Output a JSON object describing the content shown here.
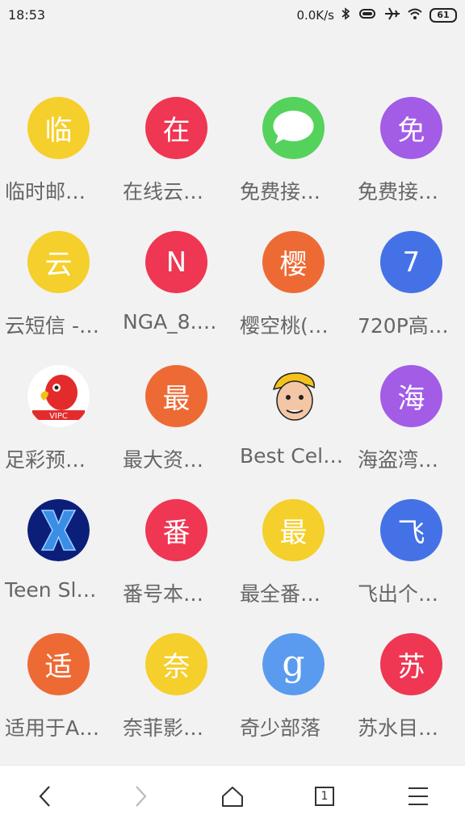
{
  "status": {
    "time": "18:53",
    "net_speed": "0.0K/s",
    "battery": "61"
  },
  "tiles": [
    {
      "glyph": "临",
      "label": "临时邮…",
      "color": "#f5cf2b",
      "icon": "text"
    },
    {
      "glyph": "在",
      "label": "在线云…",
      "color": "#ef3652",
      "icon": "text"
    },
    {
      "glyph": "",
      "label": "免费接…",
      "color": "#4cd35d",
      "icon": "message-icon"
    },
    {
      "glyph": "免",
      "label": "免费接…",
      "color": "#a35ce6",
      "icon": "text"
    },
    {
      "glyph": "云",
      "label": "云短信 -…",
      "color": "#f5cf2b",
      "icon": "text"
    },
    {
      "glyph": "N",
      "label": "NGA_8.…",
      "color": "#ef3652",
      "icon": "text"
    },
    {
      "glyph": "樱",
      "label": "樱空桃(…",
      "color": "#ee6a34",
      "icon": "text"
    },
    {
      "glyph": "7",
      "label": "720P高…",
      "color": "#4472e6",
      "icon": "text"
    },
    {
      "glyph": "",
      "label": "足彩预…",
      "color": "#ffffff",
      "icon": "parrot-icon"
    },
    {
      "glyph": "最",
      "label": "最大资…",
      "color": "#ee6a34",
      "icon": "text"
    },
    {
      "glyph": "",
      "label": "Best Cel…",
      "color": "#f2f2f2",
      "icon": "cartoon-face-icon"
    },
    {
      "glyph": "海",
      "label": "海盗湾…",
      "color": "#a35ce6",
      "icon": "text"
    },
    {
      "glyph": "X",
      "label": "Teen Sl…",
      "color": "#0b1f7a",
      "icon": "x-logo-icon"
    },
    {
      "glyph": "番",
      "label": "番号本…",
      "color": "#ef3652",
      "icon": "text"
    },
    {
      "glyph": "最",
      "label": "最全番…",
      "color": "#f5cf2b",
      "icon": "text"
    },
    {
      "glyph": "飞",
      "label": "飞出个…",
      "color": "#4472e6",
      "icon": "text"
    },
    {
      "glyph": "适",
      "label": "适用于A…",
      "color": "#ee6a34",
      "icon": "text"
    },
    {
      "glyph": "奈",
      "label": "奈菲影…",
      "color": "#f5cf2b",
      "icon": "text"
    },
    {
      "glyph": "g",
      "label": "奇少部落",
      "color": "#5a9bef",
      "icon": "google-g-icon"
    },
    {
      "glyph": "苏",
      "label": "苏水目…",
      "color": "#ef3652",
      "icon": "text"
    }
  ],
  "nav": {
    "tab_count": "1"
  }
}
